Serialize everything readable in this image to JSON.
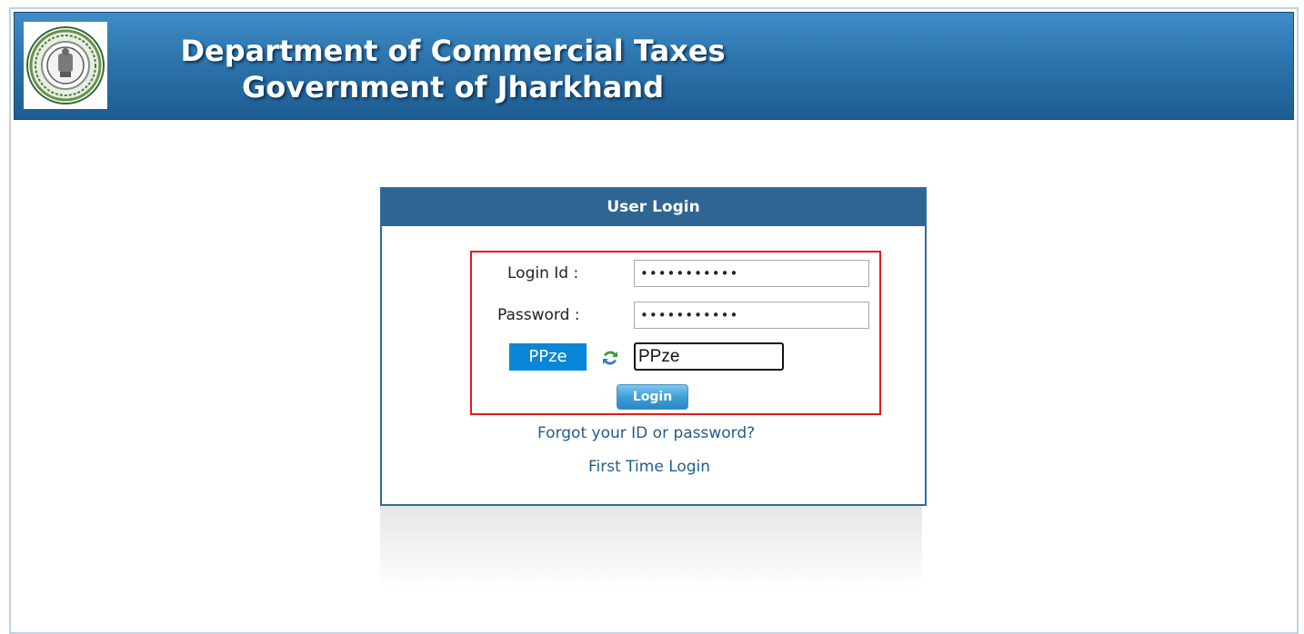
{
  "header": {
    "line1": "Department of Commercial Taxes",
    "line2": "Government of Jharkhand",
    "emblem_icon": "state-emblem-seal-icon"
  },
  "login": {
    "title": "User Login",
    "login_id_label": "Login Id :",
    "login_id_value": "•••••••••••",
    "password_label": "Password :",
    "password_value": "•••••••••••",
    "captcha_text": "PPze",
    "captcha_input_value": "PPze",
    "refresh_icon": "refresh-icon",
    "login_button": "Login",
    "forgot_link": "Forgot your ID or password?",
    "first_time_link": "First Time Login"
  },
  "colors": {
    "header_blue": "#2d74ad",
    "panel_head": "#2e6593",
    "captcha_bg": "#0a86d8",
    "highlight_red": "#e11b1b",
    "link_color": "#1f5d8c"
  }
}
